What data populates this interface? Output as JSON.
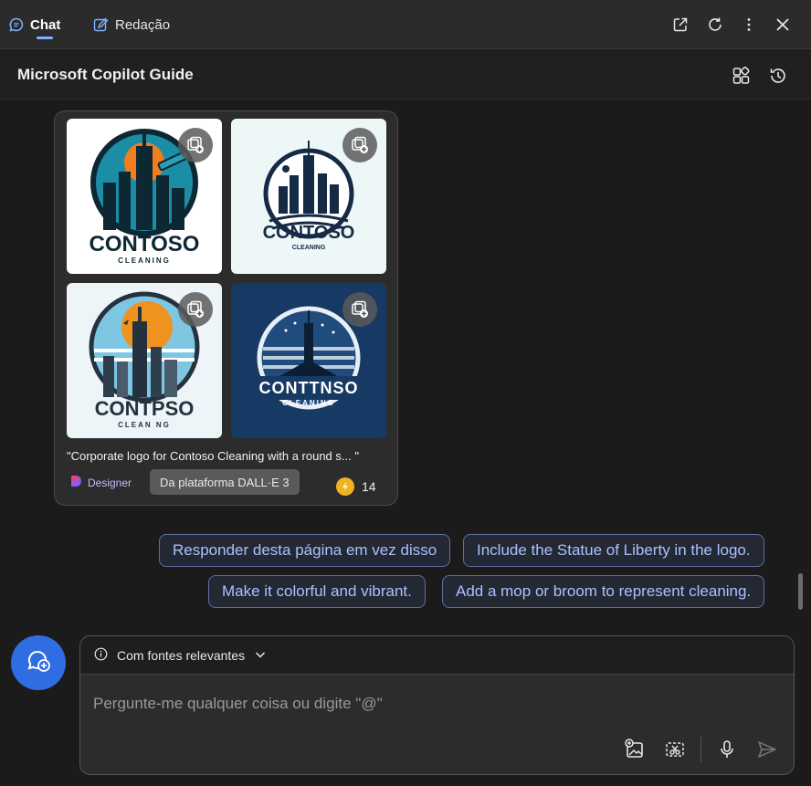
{
  "tabs": [
    {
      "label": "Chat",
      "active": true
    },
    {
      "label": "Redação",
      "active": false
    }
  ],
  "window_icons": [
    "open-external-icon",
    "refresh-icon",
    "more-icon",
    "close-icon"
  ],
  "header": {
    "title": "Microsoft Copilot Guide",
    "icons": [
      "plugins-icon",
      "history-icon"
    ]
  },
  "image_card": {
    "images": [
      {
        "brand": "CONTOSO",
        "sub": "CLEANING"
      },
      {
        "brand": "CONTOSO",
        "sub": "CLEANING"
      },
      {
        "brand": "CONTPSO",
        "sub": "CLEAN NG"
      },
      {
        "brand": "CONTTNSO",
        "sub": "CLEANING"
      }
    ],
    "caption": "\"Corporate logo for Contoso Cleaning with a round s... \"",
    "designer_label": "Designer",
    "platform_badge": "Da plataforma DALL·E 3",
    "boost_count": "14"
  },
  "suggestions": [
    "Responder desta página em vez disso",
    "Include the Statue of Liberty in the logo.",
    "Make it colorful and vibrant.",
    "Add a mop or broom to represent cleaning."
  ],
  "composer": {
    "sources_label": "Com fontes relevantes",
    "placeholder": "Pergunte-me qualquer coisa ou digite \"@\""
  },
  "colors": {
    "accent": "#2f6de3",
    "chip_text": "#a9c2ff",
    "chip_border": "#5e6ea3",
    "background": "#1c1b1b"
  }
}
